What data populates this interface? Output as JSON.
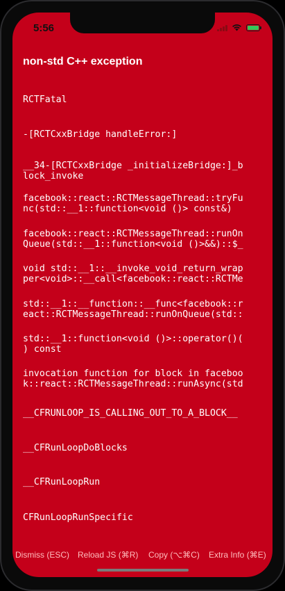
{
  "status_bar": {
    "time": "5:56",
    "icons": [
      "signal-icon",
      "wifi-icon",
      "battery-charging-icon"
    ]
  },
  "error": {
    "title": "non-std C++ exception",
    "stack": [
      "RCTFatal",
      "-[RCTCxxBridge handleError:]",
      "__34-[RCTCxxBridge _initializeBridge:]_b\nlock_invoke",
      "facebook::react::RCTMessageThread::tryFu\nnc(std::__1::function<void ()> const&)",
      "facebook::react::RCTMessageThread::runOn\nQueue(std::__1::function<void ()>&&)::$_",
      "void std::__1::__invoke_void_return_wrap\nper<void>::__call<facebook::react::RCTMe",
      "std::__1::__function::__func<facebook::r\neact::RCTMessageThread::runOnQueue(std::",
      "std::__1::function<void ()>::operator()(\n) const",
      "invocation function for block in faceboo\nk::react::RCTMessageThread::runAsync(std",
      "__CFRUNLOOP_IS_CALLING_OUT_TO_A_BLOCK__",
      "__CFRunLoopDoBlocks",
      "__CFRunLoopRun",
      "CFRunLoopRunSpecific"
    ]
  },
  "footer": {
    "dismiss": "Dismiss (ESC)",
    "reload": "Reload JS (⌘R)",
    "copy": "Copy (⌥⌘C)",
    "extra": "Extra Info (⌘E)"
  },
  "colors": {
    "background": "#c4001a",
    "text": "#ffffff",
    "footer_text": "#ffbdbd"
  }
}
